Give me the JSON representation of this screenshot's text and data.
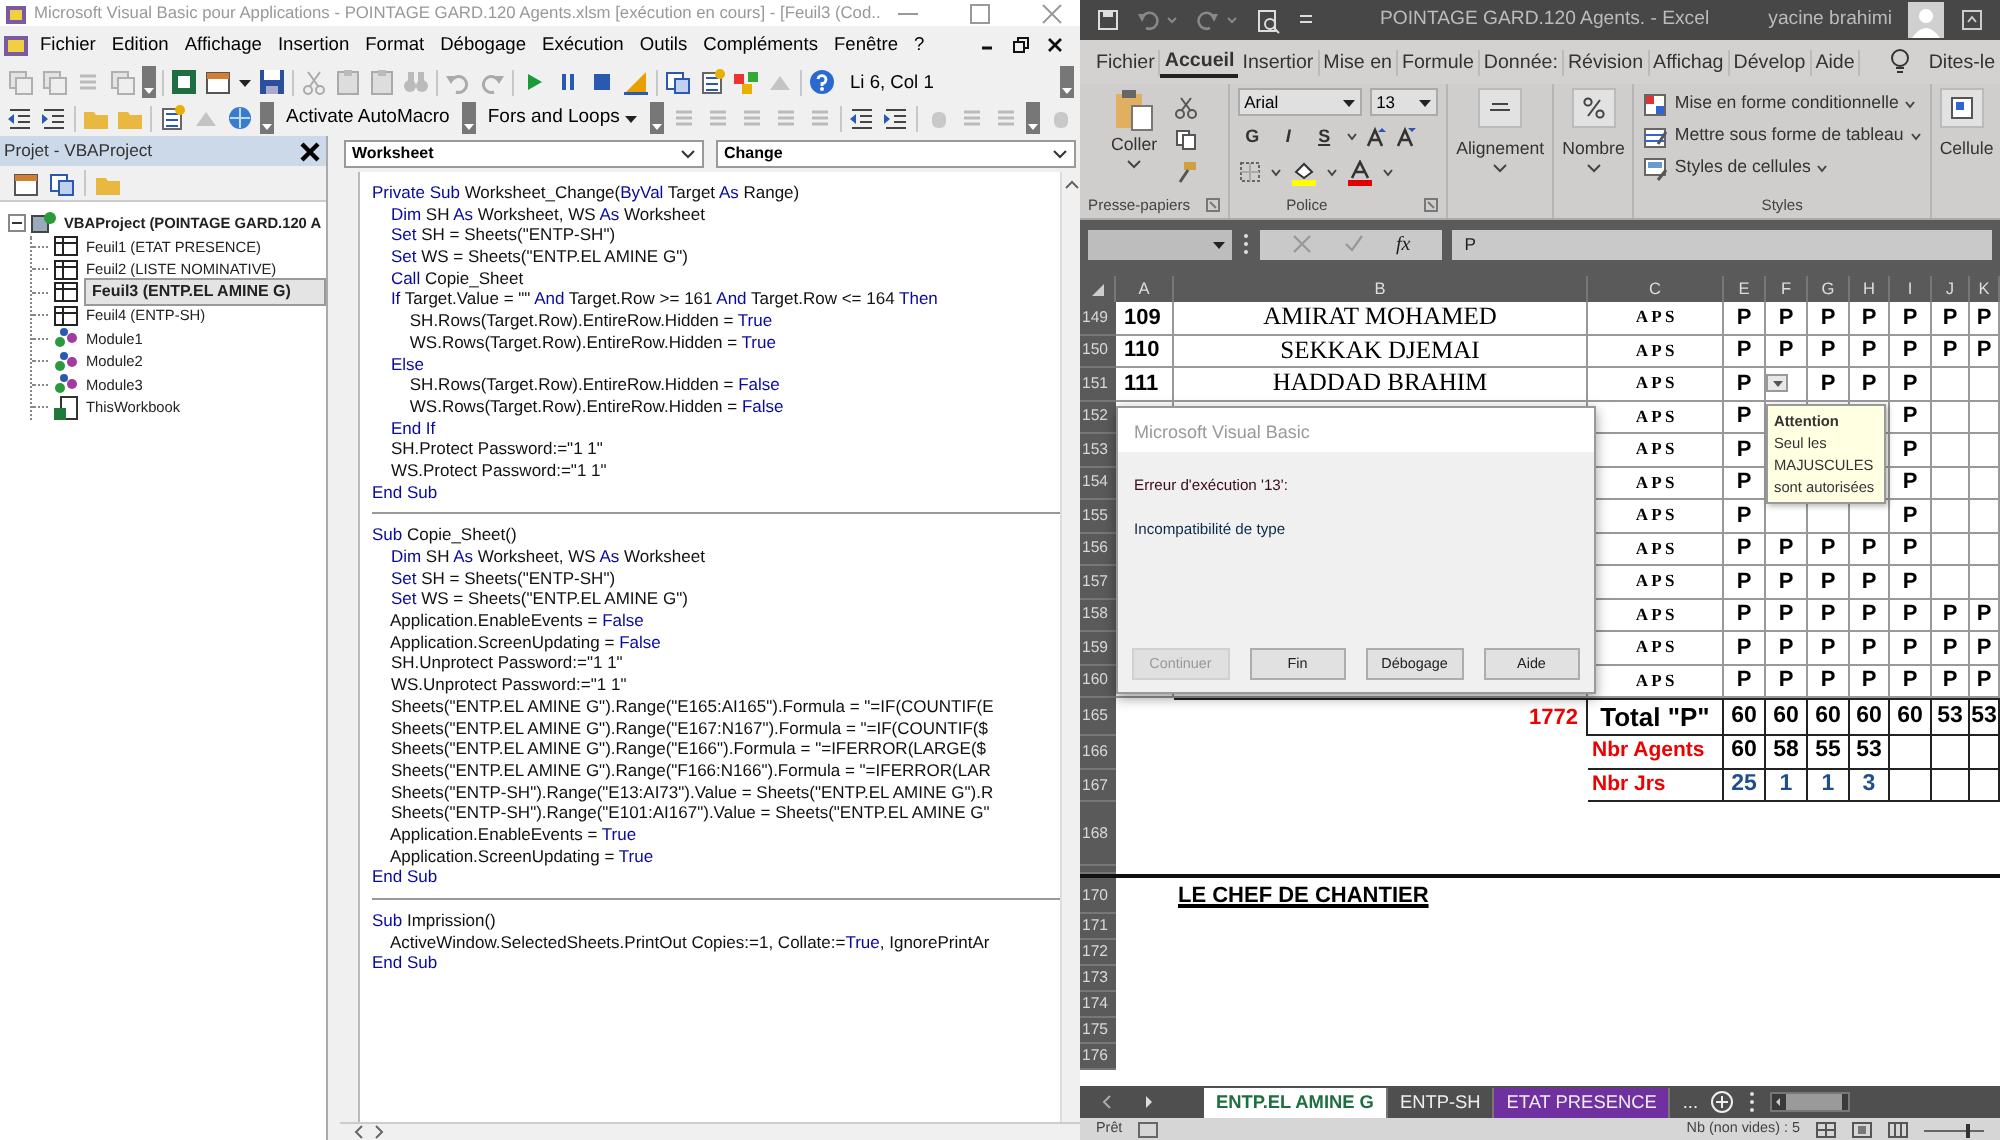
{
  "vba": {
    "title": "Microsoft Visual Basic pour Applications - POINTAGE GARD.120 Agents.xlsm [exécution en cours] - [Feuil3 (Cod..",
    "menu": [
      "Fichier",
      "Edition",
      "Affichage",
      "Insertion",
      "Format",
      "Débogage",
      "Exécution",
      "Outils",
      "Compléments",
      "Fenêtre",
      "?"
    ],
    "cursor_position": "Li 6, Col 1",
    "toolbar_buttons": [
      {
        "label": "Activate AutoMacro",
        "kind": "button"
      },
      {
        "label": "Fors and Loops",
        "kind": "menu"
      }
    ],
    "project": {
      "title": "Projet - VBAProject",
      "tree": [
        {
          "label": "VBAProject (POINTAGE GARD.120 A",
          "kind": "project",
          "expanded": true,
          "selected": false,
          "children": [
            {
              "label": "Feuil1 (ETAT PRESENCE)",
              "kind": "sheet",
              "selected": false
            },
            {
              "label": "Feuil2 (LISTE NOMINATIVE)",
              "kind": "sheet",
              "selected": false
            },
            {
              "label": "Feuil3 (ENTP.EL AMINE G)",
              "kind": "sheet",
              "selected": true
            },
            {
              "label": "Feuil4 (ENTP-SH)",
              "kind": "sheet",
              "selected": false
            },
            {
              "label": "Module1",
              "kind": "module",
              "selected": false
            },
            {
              "label": "Module2",
              "kind": "module",
              "selected": false
            },
            {
              "label": "Module3",
              "kind": "module",
              "selected": false
            },
            {
              "label": "ThisWorkbook",
              "kind": "workbook",
              "selected": false
            }
          ]
        }
      ]
    },
    "object_select": "Worksheet",
    "procedure_select": "Change",
    "procedures": [
      {
        "lines": [
          [
            {
              "text": "Private Sub",
              "kind": "keyword"
            },
            {
              "text": " Worksheet_Change(",
              "kind": "plain"
            },
            {
              "text": "ByVal",
              "kind": "keyword"
            },
            {
              "text": " Target ",
              "kind": "plain"
            },
            {
              "text": "As",
              "kind": "keyword"
            },
            {
              "text": " Range)",
              "kind": "plain"
            }
          ],
          [
            {
              "text": "    Dim",
              "kind": "keyword"
            },
            {
              "text": " SH ",
              "kind": "plain"
            },
            {
              "text": "As",
              "kind": "keyword"
            },
            {
              "text": " Worksheet, WS ",
              "kind": "plain"
            },
            {
              "text": "As",
              "kind": "keyword"
            },
            {
              "text": " Worksheet",
              "kind": "plain"
            }
          ],
          [
            {
              "text": "    Set",
              "kind": "keyword"
            },
            {
              "text": " SH = Sheets(\"ENTP-SH\")",
              "kind": "plain"
            }
          ],
          [
            {
              "text": "    Set",
              "kind": "keyword"
            },
            {
              "text": " WS = Sheets(\"ENTP.EL AMINE G\")",
              "kind": "plain"
            }
          ],
          [
            {
              "text": "    Call",
              "kind": "keyword"
            },
            {
              "text": " Copie_Sheet",
              "kind": "plain"
            }
          ],
          [
            {
              "text": "    If",
              "kind": "keyword"
            },
            {
              "text": " Target.Value = \"\" ",
              "kind": "plain"
            },
            {
              "text": "And",
              "kind": "keyword"
            },
            {
              "text": " Target.Row >= 161 ",
              "kind": "plain"
            },
            {
              "text": "And",
              "kind": "keyword"
            },
            {
              "text": " Target.Row <= 164 ",
              "kind": "plain"
            },
            {
              "text": "Then",
              "kind": "keyword"
            }
          ],
          [
            {
              "text": "        SH.Rows(Target.Row).EntireRow.Hidden = ",
              "kind": "plain"
            },
            {
              "text": "True",
              "kind": "keyword"
            }
          ],
          [
            {
              "text": "        WS.Rows(Target.Row).EntireRow.Hidden = ",
              "kind": "plain"
            },
            {
              "text": "True",
              "kind": "keyword"
            }
          ],
          [
            {
              "text": "    Else",
              "kind": "keyword"
            }
          ],
          [
            {
              "text": "        SH.Rows(Target.Row).EntireRow.Hidden = ",
              "kind": "plain"
            },
            {
              "text": "False",
              "kind": "keyword"
            }
          ],
          [
            {
              "text": "        WS.Rows(Target.Row).EntireRow.Hidden = ",
              "kind": "plain"
            },
            {
              "text": "False",
              "kind": "keyword"
            }
          ],
          [
            {
              "text": "    End If",
              "kind": "keyword"
            }
          ],
          [
            {
              "text": "    SH.Protect Password:=\"1 1\"",
              "kind": "plain"
            }
          ],
          [
            {
              "text": "    WS.Protect Password:=\"1 1\"",
              "kind": "plain"
            }
          ],
          [
            {
              "text": "End Sub",
              "kind": "keyword"
            }
          ]
        ]
      },
      {
        "lines": [
          [
            {
              "text": "Sub",
              "kind": "keyword"
            },
            {
              "text": " Copie_Sheet()",
              "kind": "plain"
            }
          ],
          [
            {
              "text": "    Dim",
              "kind": "keyword"
            },
            {
              "text": " SH ",
              "kind": "plain"
            },
            {
              "text": "As",
              "kind": "keyword"
            },
            {
              "text": " Worksheet, WS ",
              "kind": "plain"
            },
            {
              "text": "As",
              "kind": "keyword"
            },
            {
              "text": " Worksheet",
              "kind": "plain"
            }
          ],
          [
            {
              "text": "    Set",
              "kind": "keyword"
            },
            {
              "text": " SH = Sheets(\"ENTP-SH\")",
              "kind": "plain"
            }
          ],
          [
            {
              "text": "    Set",
              "kind": "keyword"
            },
            {
              "text": " WS = Sheets(\"ENTP.EL AMINE G\")",
              "kind": "plain"
            }
          ],
          [
            {
              "text": "    Application.EnableEvents = ",
              "kind": "plain"
            },
            {
              "text": "False",
              "kind": "keyword"
            }
          ],
          [
            {
              "text": "    Application.ScreenUpdating = ",
              "kind": "plain"
            },
            {
              "text": "False",
              "kind": "keyword"
            }
          ],
          [
            {
              "text": "    SH.Unprotect Password:=\"1 1\"",
              "kind": "plain"
            }
          ],
          [
            {
              "text": "    WS.Unprotect Password:=\"1 1\"",
              "kind": "plain"
            }
          ],
          [
            {
              "text": "    Sheets(\"ENTP.EL AMINE G\").Range(\"E165:AI165\").Formula = \"=IF(COUNTIF(E",
              "kind": "plain"
            }
          ],
          [
            {
              "text": "    Sheets(\"ENTP.EL AMINE G\").Range(\"E167:N167\").Formula = \"=IF(COUNTIF($",
              "kind": "plain"
            }
          ],
          [
            {
              "text": "    Sheets(\"ENTP.EL AMINE G\").Range(\"E166\").Formula = \"=IFERROR(LARGE($",
              "kind": "plain"
            }
          ],
          [
            {
              "text": "    Sheets(\"ENTP.EL AMINE G\").Range(\"F166:N166\").Formula = \"=IFERROR(LAR",
              "kind": "plain"
            }
          ],
          [
            {
              "text": "    Sheets(\"ENTP-SH\").Range(\"E13:AI73\").Value = Sheets(\"ENTP.EL AMINE G\").R",
              "kind": "plain"
            }
          ],
          [
            {
              "text": "    Sheets(\"ENTP-SH\").Range(\"E101:AI167\").Value = Sheets(\"ENTP.EL AMINE G\"",
              "kind": "plain"
            }
          ],
          [
            {
              "text": "    Application.EnableEvents = ",
              "kind": "plain"
            },
            {
              "text": "True",
              "kind": "keyword"
            }
          ],
          [
            {
              "text": "    Application.ScreenUpdating = ",
              "kind": "plain"
            },
            {
              "text": "True",
              "kind": "keyword"
            }
          ],
          [
            {
              "text": "End Sub",
              "kind": "keyword"
            }
          ]
        ]
      },
      {
        "lines": [
          [
            {
              "text": "Sub",
              "kind": "keyword"
            },
            {
              "text": " Imprission()",
              "kind": "plain"
            }
          ],
          [
            {
              "text": "    ActiveWindow.SelectedSheets.PrintOut Copies:=1, Collate:=",
              "kind": "plain"
            },
            {
              "text": "True",
              "kind": "keyword"
            },
            {
              "text": ", IgnorePrintAr",
              "kind": "plain"
            }
          ],
          [
            {
              "text": "End Sub",
              "kind": "keyword"
            }
          ]
        ]
      }
    ]
  },
  "excel": {
    "title": "POINTAGE GARD.120 Agents.  -  Excel",
    "user": "yacine brahimi",
    "tabs": [
      {
        "label": "Fichier",
        "selected": false
      },
      {
        "label": "Accueil",
        "selected": true
      },
      {
        "label": "Insertior",
        "selected": false
      },
      {
        "label": "Mise en",
        "selected": false
      },
      {
        "label": "Formule",
        "selected": false
      },
      {
        "label": "Donnée:",
        "selected": false
      },
      {
        "label": "Révision",
        "selected": false
      },
      {
        "label": "Affichag",
        "selected": false
      },
      {
        "label": "Dévelop",
        "selected": false
      },
      {
        "label": "Aide",
        "selected": false
      }
    ],
    "tell_me": "Dites-le",
    "ribbon": {
      "paste": "Coller",
      "clipboard_group": "Presse-papiers",
      "font_family": "Arial",
      "font_size": "13",
      "font_styles": [
        "G",
        "I",
        "S"
      ],
      "font_group": "Police",
      "alignment": "Alignement",
      "number": "Nombre",
      "style_items": [
        "Mise en forme conditionnelle",
        "Mettre sous forme de tableau",
        "Styles de cellules"
      ],
      "styles_group": "Styles",
      "cells": "Cellule"
    },
    "formula_bar": {
      "function_label": "fx",
      "value": "P"
    },
    "columns": [
      "A",
      "B",
      "C",
      "E",
      "F",
      "G",
      "H",
      "I",
      "J",
      "K"
    ],
    "rows": [
      {
        "num": "149",
        "kind": "agent",
        "a": "109",
        "b": "AMIRAT MOHAMED",
        "c": "A P S",
        "marks": [
          {
            "kind": "value",
            "text": "P"
          },
          {
            "kind": "value",
            "text": "P"
          },
          {
            "kind": "value",
            "text": "P"
          },
          {
            "kind": "value",
            "text": "P"
          },
          {
            "kind": "value",
            "text": "P"
          },
          {
            "kind": "value",
            "text": "P"
          },
          {
            "kind": "value",
            "text": "P"
          }
        ]
      },
      {
        "num": "150",
        "kind": "agent",
        "a": "110",
        "b": "SEKKAK  DJEMAI",
        "c": "A P S",
        "marks": [
          {
            "kind": "value",
            "text": "P"
          },
          {
            "kind": "value",
            "text": "P"
          },
          {
            "kind": "value",
            "text": "P"
          },
          {
            "kind": "value",
            "text": "P"
          },
          {
            "kind": "value",
            "text": "P"
          },
          {
            "kind": "value",
            "text": "P"
          },
          {
            "kind": "value",
            "text": "P"
          }
        ]
      },
      {
        "num": "151",
        "kind": "agent",
        "a": "111",
        "b": "HADDAD  BRAHIM",
        "c": "A P S",
        "marks": [
          {
            "kind": "value",
            "text": "P"
          },
          {
            "kind": "dropdown"
          },
          {
            "kind": "value",
            "text": "P"
          },
          {
            "kind": "value",
            "text": "P"
          },
          {
            "kind": "value",
            "text": "P"
          },
          {
            "kind": "empty"
          },
          {
            "kind": "empty"
          }
        ]
      },
      {
        "num": "152",
        "kind": "agent",
        "c": "A P S",
        "marks": [
          {
            "kind": "value",
            "text": "P"
          },
          {
            "kind": "covered"
          },
          {
            "kind": "covered"
          },
          {
            "kind": "covered"
          },
          {
            "kind": "value",
            "text": "P"
          },
          {
            "kind": "empty"
          },
          {
            "kind": "empty"
          }
        ]
      },
      {
        "num": "153",
        "kind": "agent",
        "c": "A P S",
        "marks": [
          {
            "kind": "value",
            "text": "P"
          },
          {
            "kind": "covered"
          },
          {
            "kind": "covered"
          },
          {
            "kind": "covered"
          },
          {
            "kind": "value",
            "text": "P"
          },
          {
            "kind": "empty"
          },
          {
            "kind": "empty"
          }
        ]
      },
      {
        "num": "154",
        "kind": "agent",
        "c": "A P S",
        "marks": [
          {
            "kind": "value",
            "text": "P"
          },
          {
            "kind": "covered"
          },
          {
            "kind": "covered"
          },
          {
            "kind": "covered"
          },
          {
            "kind": "value",
            "text": "P"
          },
          {
            "kind": "empty"
          },
          {
            "kind": "empty"
          }
        ]
      },
      {
        "num": "155",
        "kind": "agent",
        "c": "A P S",
        "marks": [
          {
            "kind": "value",
            "text": "P"
          },
          {
            "kind": "covered"
          },
          {
            "kind": "covered"
          },
          {
            "kind": "covered"
          },
          {
            "kind": "value",
            "text": "P"
          },
          {
            "kind": "empty"
          },
          {
            "kind": "empty"
          }
        ]
      },
      {
        "num": "156",
        "kind": "agent",
        "c": "A P S",
        "marks": [
          {
            "kind": "value",
            "text": "P"
          },
          {
            "kind": "value",
            "text": "P"
          },
          {
            "kind": "value",
            "text": "P"
          },
          {
            "kind": "value",
            "text": "P"
          },
          {
            "kind": "value",
            "text": "P"
          },
          {
            "kind": "empty"
          },
          {
            "kind": "empty"
          }
        ]
      },
      {
        "num": "157",
        "kind": "agent",
        "c": "A P S",
        "marks": [
          {
            "kind": "value",
            "text": "P"
          },
          {
            "kind": "value",
            "text": "P"
          },
          {
            "kind": "value",
            "text": "P"
          },
          {
            "kind": "value",
            "text": "P"
          },
          {
            "kind": "value",
            "text": "P"
          },
          {
            "kind": "empty"
          },
          {
            "kind": "empty"
          }
        ]
      },
      {
        "num": "158",
        "kind": "agent",
        "c": "A P S",
        "marks": [
          {
            "kind": "value",
            "text": "P"
          },
          {
            "kind": "value",
            "text": "P"
          },
          {
            "kind": "value",
            "text": "P"
          },
          {
            "kind": "value",
            "text": "P"
          },
          {
            "kind": "value",
            "text": "P"
          },
          {
            "kind": "value",
            "text": "P"
          },
          {
            "kind": "value",
            "text": "P"
          }
        ]
      },
      {
        "num": "159",
        "kind": "agent",
        "c": "A P S",
        "marks": [
          {
            "kind": "value",
            "text": "P"
          },
          {
            "kind": "value",
            "text": "P"
          },
          {
            "kind": "value",
            "text": "P"
          },
          {
            "kind": "value",
            "text": "P"
          },
          {
            "kind": "value",
            "text": "P"
          },
          {
            "kind": "value",
            "text": "P"
          },
          {
            "kind": "value",
            "text": "P"
          }
        ]
      },
      {
        "num": "160",
        "kind": "agent",
        "c": "A P S",
        "marks": [
          {
            "kind": "value",
            "text": "P"
          },
          {
            "kind": "value",
            "text": "P"
          },
          {
            "kind": "value",
            "text": "P"
          },
          {
            "kind": "value",
            "text": "P"
          },
          {
            "kind": "value",
            "text": "P"
          },
          {
            "kind": "value",
            "text": "P"
          },
          {
            "kind": "value",
            "text": "P"
          }
        ]
      },
      {
        "num": "165",
        "kind": "total",
        "b": "1772",
        "c": "Total \"P\"",
        "marks": [
          {
            "kind": "value",
            "text": "60"
          },
          {
            "kind": "value",
            "text": "60"
          },
          {
            "kind": "value",
            "text": "60"
          },
          {
            "kind": "value",
            "text": "60"
          },
          {
            "kind": "value",
            "text": "60"
          },
          {
            "kind": "value",
            "text": "53"
          },
          {
            "kind": "value",
            "text": "53"
          }
        ]
      },
      {
        "num": "166",
        "kind": "agents",
        "c": "Nbr  Agents",
        "marks": [
          {
            "kind": "value",
            "text": "60"
          },
          {
            "kind": "value",
            "text": "58"
          },
          {
            "kind": "value",
            "text": "55"
          },
          {
            "kind": "value",
            "text": "53"
          },
          {
            "kind": "empty"
          },
          {
            "kind": "empty"
          },
          {
            "kind": "empty"
          }
        ]
      },
      {
        "num": "167",
        "kind": "days",
        "c": "Nbr Jrs",
        "marks": [
          {
            "kind": "value",
            "text": "25"
          },
          {
            "kind": "value",
            "text": "1"
          },
          {
            "kind": "value",
            "text": "1"
          },
          {
            "kind": "value",
            "text": "3"
          },
          {
            "kind": "empty"
          },
          {
            "kind": "empty"
          },
          {
            "kind": "empty"
          }
        ]
      },
      {
        "num": "168",
        "kind": "gap"
      },
      {
        "kind": "thin"
      },
      {
        "num": "170",
        "kind": "signature",
        "b": "LE CHEF DE CHANTIER"
      },
      {
        "num": "171",
        "kind": "blank"
      },
      {
        "num": "172",
        "kind": "blank"
      },
      {
        "num": "173",
        "kind": "blank"
      },
      {
        "num": "174",
        "kind": "blank"
      },
      {
        "num": "175",
        "kind": "blank"
      },
      {
        "num": "176",
        "kind": "blank"
      }
    ],
    "sheet_tabs": [
      {
        "label": "ENTP.EL AMINE G",
        "selected": true
      },
      {
        "label": "ENTP-SH",
        "selected": false
      },
      {
        "label": "ETAT PRESENCE",
        "selected": false,
        "color": "#7030a0"
      }
    ],
    "more_tabs": "...",
    "status": {
      "ready": "Prêt",
      "count": "Nb (non vides) : 5",
      "zoom": {
        "level": 0.75
      }
    }
  },
  "dialog": {
    "title": "Microsoft Visual Basic",
    "error": "Erreur d'exécution '13':",
    "message": "Incompatibilité de type",
    "buttons": [
      {
        "label": "Continuer",
        "disabled": true
      },
      {
        "label": "Fin",
        "disabled": false
      },
      {
        "label": "Débogage",
        "disabled": false
      },
      {
        "label": "Aide",
        "disabled": false
      }
    ]
  },
  "tooltip": {
    "title": "Attention",
    "text": "Seul les MAJUSCULES sont autorisées"
  }
}
